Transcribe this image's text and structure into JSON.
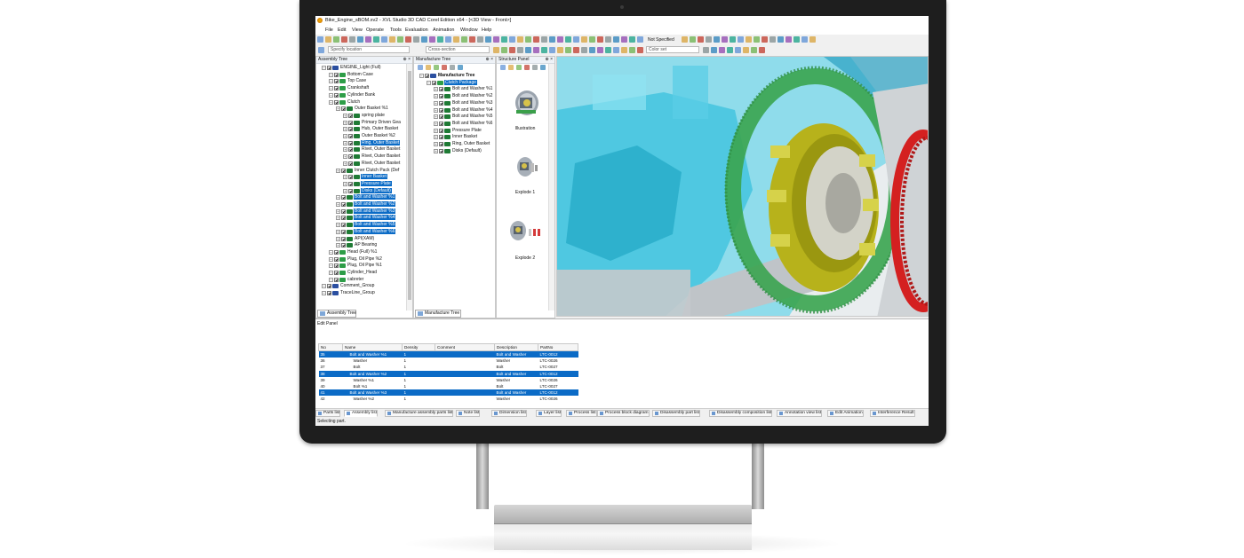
{
  "window": {
    "title": "Bike_Engine_sBOM.xv2 - XVL Studio 3D CAD Corel Edition x64 - [<3D View - Front>]"
  },
  "menu": [
    "File",
    "Edit",
    "View",
    "Operate",
    "Tools",
    "Evaluation",
    "Animation",
    "Window",
    "Help"
  ],
  "toolbar": {
    "location_placeholder": "Specify location",
    "cross_section": "Cross-section",
    "not_specified": "Not Specified",
    "color_set": "Color set"
  },
  "assembly_tree": {
    "header": "Assembly Tree",
    "tab": "Assembly Tree",
    "rows": [
      {
        "label": "ENGINE_Light (Full)",
        "depth": 0,
        "selected": false
      },
      {
        "label": "Bottom Case",
        "depth": 1,
        "selected": false
      },
      {
        "label": "Top Case",
        "depth": 1,
        "selected": false
      },
      {
        "label": "Crankshaft",
        "depth": 1,
        "selected": false
      },
      {
        "label": "Cylinder Bank",
        "depth": 1,
        "selected": false
      },
      {
        "label": "Clutch",
        "depth": 1,
        "selected": false
      },
      {
        "label": "Outer Basket %1",
        "depth": 2,
        "selected": false
      },
      {
        "label": "spring plate",
        "depth": 3,
        "selected": false
      },
      {
        "label": "Primary Driven Gea",
        "depth": 3,
        "selected": false
      },
      {
        "label": "Hub, Outer Basket",
        "depth": 3,
        "selected": false
      },
      {
        "label": "Outer Basket %2",
        "depth": 3,
        "selected": false
      },
      {
        "label": "Ring, Outer Basket",
        "depth": 3,
        "selected": true
      },
      {
        "label": "Rivet, Outer Basket",
        "depth": 3,
        "selected": false
      },
      {
        "label": "Rivet, Outer Basket",
        "depth": 3,
        "selected": false
      },
      {
        "label": "Rivet, Outer Basket",
        "depth": 3,
        "selected": false
      },
      {
        "label": "Inner Clutch Pack (Def",
        "depth": 2,
        "selected": false
      },
      {
        "label": "Inner Basket",
        "depth": 3,
        "selected": true
      },
      {
        "label": "Pressure Plate",
        "depth": 3,
        "selected": true
      },
      {
        "label": "Disks (Default)",
        "depth": 3,
        "selected": true
      },
      {
        "label": "Bolt and Washer %1",
        "depth": 2,
        "selected": true
      },
      {
        "label": "Bolt and Washer %2",
        "depth": 2,
        "selected": true
      },
      {
        "label": "Bolt and Washer %3",
        "depth": 2,
        "selected": true
      },
      {
        "label": "Bolt and Washer %4",
        "depth": 2,
        "selected": true
      },
      {
        "label": "Bolt and Washer %5",
        "depth": 2,
        "selected": true
      },
      {
        "label": "Bolt and Washer %6",
        "depth": 2,
        "selected": true
      },
      {
        "label": "API(XAM)",
        "depth": 2,
        "selected": false
      },
      {
        "label": "AP Bearing",
        "depth": 2,
        "selected": false
      },
      {
        "label": "Head (Full) %1",
        "depth": 1,
        "selected": false
      },
      {
        "label": "Plug, Oil Pipe %2",
        "depth": 1,
        "selected": false
      },
      {
        "label": "Plug, Oil Pipe %1",
        "depth": 1,
        "selected": false
      },
      {
        "label": "Cylinder_Head",
        "depth": 1,
        "selected": false
      },
      {
        "label": "cabreter",
        "depth": 1,
        "selected": false
      },
      {
        "label": "Comment_Group",
        "depth": 0,
        "selected": false
      },
      {
        "label": "TraceLine_Group",
        "depth": 0,
        "selected": false
      }
    ]
  },
  "manufacture_tree": {
    "header": "Manufacture Tree",
    "tab": "Manufacture Tree",
    "rows": [
      {
        "label": "Manufacture Tree",
        "depth": 0,
        "selected": false,
        "bold": true
      },
      {
        "label": "Clutch Package",
        "depth": 1,
        "selected": true,
        "bold": false
      },
      {
        "label": "Bolt and Washer %1",
        "depth": 2,
        "selected": false,
        "bold": false
      },
      {
        "label": "Bolt and Washer %2",
        "depth": 2,
        "selected": false,
        "bold": false
      },
      {
        "label": "Bolt and Washer %3",
        "depth": 2,
        "selected": false,
        "bold": false
      },
      {
        "label": "Bolt and Washer %4",
        "depth": 2,
        "selected": false,
        "bold": false
      },
      {
        "label": "Bolt and Washer %5",
        "depth": 2,
        "selected": false,
        "bold": false
      },
      {
        "label": "Bolt and Washer %6",
        "depth": 2,
        "selected": false,
        "bold": false
      },
      {
        "label": "Pressure Plate",
        "depth": 2,
        "selected": false,
        "bold": false
      },
      {
        "label": "Inner Basket",
        "depth": 2,
        "selected": false,
        "bold": false
      },
      {
        "label": "Ring, Outer Basket",
        "depth": 2,
        "selected": false,
        "bold": false
      },
      {
        "label": "Disks (Default)",
        "depth": 2,
        "selected": false,
        "bold": false
      }
    ]
  },
  "structure_panel": {
    "header": "Structure Panel",
    "items": [
      {
        "label": "Illustration"
      },
      {
        "label": "Explode 1"
      },
      {
        "label": "Explode 2"
      }
    ]
  },
  "edit_panel": {
    "title": "Edit Panel",
    "columns": [
      "No",
      "Name",
      "Density",
      "Comment",
      "Description",
      "PartNo"
    ],
    "rows": [
      {
        "no": "35",
        "name": "Bolt and Washer %1",
        "density": "1",
        "comment": "",
        "description": "Bolt and Washer",
        "partno": "LTC-0012",
        "selected": true,
        "indent": true
      },
      {
        "no": "36",
        "name": "Washer",
        "density": "1",
        "comment": "",
        "description": "Washer",
        "partno": "LTC-0026",
        "selected": false,
        "indent": true
      },
      {
        "no": "37",
        "name": "Bolt",
        "density": "1",
        "comment": "",
        "description": "Bolt",
        "partno": "LTC-0027",
        "selected": false,
        "indent": true
      },
      {
        "no": "38",
        "name": "Bolt and Washer %2",
        "density": "1",
        "comment": "",
        "description": "Bolt and Washer",
        "partno": "LTC-0012",
        "selected": true,
        "indent": true
      },
      {
        "no": "39",
        "name": "Washer %1",
        "density": "1",
        "comment": "",
        "description": "Washer",
        "partno": "LTC-0026",
        "selected": false,
        "indent": true
      },
      {
        "no": "40",
        "name": "Bolt %1",
        "density": "1",
        "comment": "",
        "description": "Bolt",
        "partno": "LTC-0027",
        "selected": false,
        "indent": true
      },
      {
        "no": "41",
        "name": "Bolt and Washer %3",
        "density": "1",
        "comment": "",
        "description": "Bolt and Washer",
        "partno": "LTC-0012",
        "selected": true,
        "indent": true
      },
      {
        "no": "42",
        "name": "Washer %2",
        "density": "1",
        "comment": "",
        "description": "Washer",
        "partno": "LTC-0026",
        "selected": false,
        "indent": true
      }
    ]
  },
  "bottom_tabs": [
    {
      "label": "Parts list",
      "active": false
    },
    {
      "label": "Assembly list",
      "active": true
    },
    {
      "label": "Manufacture assembly parts list",
      "active": false
    },
    {
      "label": "Note list",
      "active": false
    },
    {
      "label": "Dimension list",
      "active": false
    },
    {
      "label": "Layer list",
      "active": false
    },
    {
      "label": "Process list",
      "active": false
    },
    {
      "label": "Process block diagram",
      "active": false
    },
    {
      "label": "Disassembly part list",
      "active": false
    },
    {
      "label": "Disassembly composition list",
      "active": false
    },
    {
      "label": "Annotation view list",
      "active": false
    },
    {
      "label": "Edit Animation",
      "active": false
    },
    {
      "label": "Interference Result",
      "active": false
    }
  ],
  "status": "Selecting part.",
  "colors": {
    "selection": "#0b6bc6",
    "housing_cyan": "#35c4e0",
    "basket_yellow": "#b8b400",
    "disk_red": "#d42020",
    "gear_green": "#3aa44f"
  }
}
